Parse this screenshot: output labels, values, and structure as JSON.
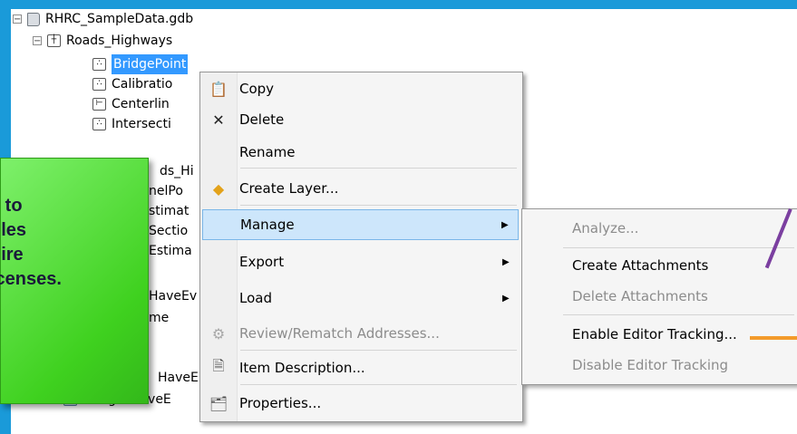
{
  "tree": {
    "root": "RHRC_SampleData.gdb",
    "dataset": "Roads_Highways",
    "items": [
      {
        "label": "BridgePoint",
        "selected": true,
        "icon": "point-feature-class-icon"
      },
      {
        "label": "Calibratio"
      },
      {
        "label": "Centerlin"
      },
      {
        "label": "Intersecti"
      },
      {
        "label": "ds_Hi"
      },
      {
        "label": "nelPo"
      },
      {
        "label": "stimat"
      },
      {
        "label": "Sectio"
      },
      {
        "label": "Estima"
      },
      {
        "label": "HaveEv"
      },
      {
        "label": "me"
      },
      {
        "label": "HaveE"
      },
      {
        "label": "BridgesHaveE"
      }
    ]
  },
  "context_menu": {
    "items": [
      {
        "label": "Copy",
        "icon": "copy-icon"
      },
      {
        "label": "Delete",
        "icon": "delete-x-icon"
      },
      {
        "label": "Rename"
      },
      {
        "label": "Create Layer...",
        "icon": "layer-diamond-icon"
      },
      {
        "label": "Manage",
        "submenu": true,
        "highlighted": true
      },
      {
        "label": "Export",
        "submenu": true
      },
      {
        "label": "Load",
        "submenu": true
      },
      {
        "label": "Review/Rematch Addresses...",
        "disabled": true,
        "icon": "rematch-icon"
      },
      {
        "label": "Item Description...",
        "icon": "document-icon"
      },
      {
        "label": "Properties...",
        "icon": "properties-icon"
      }
    ]
  },
  "submenu": {
    "items": [
      {
        "label": "Analyze...",
        "disabled": true
      },
      {
        "label": "Create Attachments"
      },
      {
        "label": "Delete Attachments",
        "disabled": true
      },
      {
        "label": "Enable Editor Tracking..."
      },
      {
        "label": "Disable Editor Tracking",
        "disabled": true
      }
    ]
  },
  "callout": {
    "text": "e\ns to\nfiles\nuire\nicenses."
  },
  "colors": {
    "accent": "#1a9ad9",
    "callout": "#4fdc2f",
    "arrow_purple": "#7b3fa0",
    "arrow_orange": "#f39b2b"
  }
}
